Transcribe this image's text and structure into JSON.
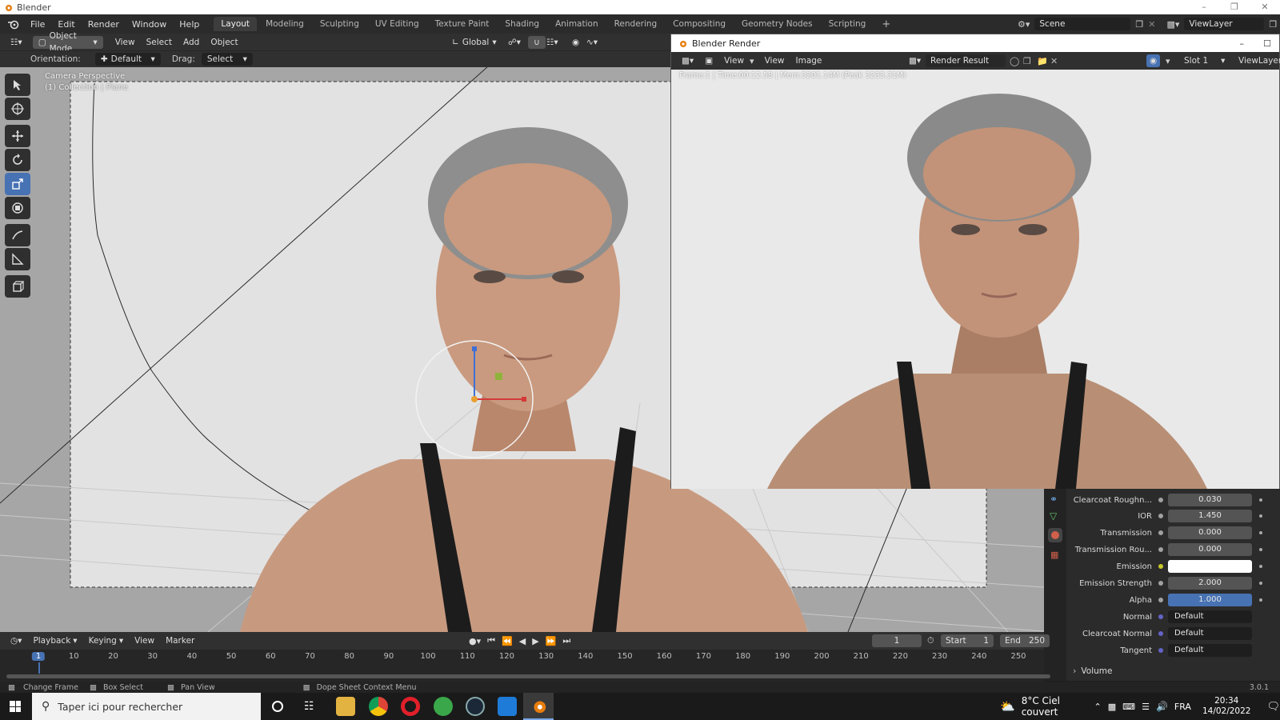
{
  "titlebar": {
    "title": "Blender"
  },
  "menu": {
    "items": [
      "File",
      "Edit",
      "Render",
      "Window",
      "Help"
    ]
  },
  "workspace_tabs": [
    "Layout",
    "Modeling",
    "Sculpting",
    "UV Editing",
    "Texture Paint",
    "Shading",
    "Animation",
    "Rendering",
    "Compositing",
    "Geometry Nodes",
    "Scripting"
  ],
  "active_tab": "Layout",
  "scene": {
    "name": "Scene",
    "view_layer": "ViewLayer"
  },
  "viewport": {
    "mode": "Object Mode",
    "menus": [
      "View",
      "Select",
      "Add",
      "Object"
    ],
    "transform_orientation": "Global",
    "orientation_label": "Orientation:",
    "orientation_value": "Default",
    "drag_label": "Drag:",
    "drag_value": "Select Las...",
    "overlay_line1": "Camera Perspective",
    "overlay_line2": "(1) Collection | Plane"
  },
  "render_window": {
    "title": "Blender Render",
    "menus": [
      "View",
      "View",
      "Image"
    ],
    "result": "Render Result",
    "slot": "Slot 1",
    "view_layer": "ViewLayer",
    "info": "Frame:1 | Time:00:12.58 | Mem:3201.14M (Peak 3233.31M)"
  },
  "properties": {
    "rows": [
      {
        "label": "Clearcoat Roughn...",
        "value": "0.030",
        "style": "normal"
      },
      {
        "label": "IOR",
        "value": "1.450",
        "style": "normal"
      },
      {
        "label": "Transmission",
        "value": "0.000",
        "style": "normal"
      },
      {
        "label": "Transmission Rou...",
        "value": "0.000",
        "style": "normal"
      },
      {
        "label": "Emission",
        "value": "",
        "style": "white"
      },
      {
        "label": "Emission Strength",
        "value": "2.000",
        "style": "normal"
      },
      {
        "label": "Alpha",
        "value": "1.000",
        "style": "blue"
      },
      {
        "label": "Normal",
        "value": "Default",
        "style": "dark"
      },
      {
        "label": "Clearcoat Normal",
        "value": "Default",
        "style": "dark"
      },
      {
        "label": "Tangent",
        "value": "Default",
        "style": "dark"
      }
    ],
    "volume_label": "Volume"
  },
  "timeline": {
    "menus": [
      "Playback",
      "Keying",
      "View",
      "Marker"
    ],
    "current_frame": "1",
    "start_label": "Start",
    "start": "1",
    "end_label": "End",
    "end": "250",
    "ticks": [
      "1",
      "10",
      "20",
      "30",
      "40",
      "50",
      "60",
      "70",
      "80",
      "90",
      "100",
      "110",
      "120",
      "130",
      "140",
      "150",
      "160",
      "170",
      "180",
      "190",
      "200",
      "210",
      "220",
      "230",
      "240",
      "250"
    ]
  },
  "status": {
    "change_frame": "Change Frame",
    "box_select": "Box Select",
    "pan_view": "Pan View",
    "context_menu": "Dope Sheet Context Menu",
    "version": "3.0.1"
  },
  "taskbar": {
    "search_placeholder": "Taper ici pour rechercher",
    "weather": "8°C Ciel couvert",
    "language": "FRA",
    "time": "20:34",
    "date": "14/02/2022"
  },
  "colors": {
    "accent": "#4772b3",
    "viewport_bg": "#a3a3a3",
    "header": "#303030"
  }
}
